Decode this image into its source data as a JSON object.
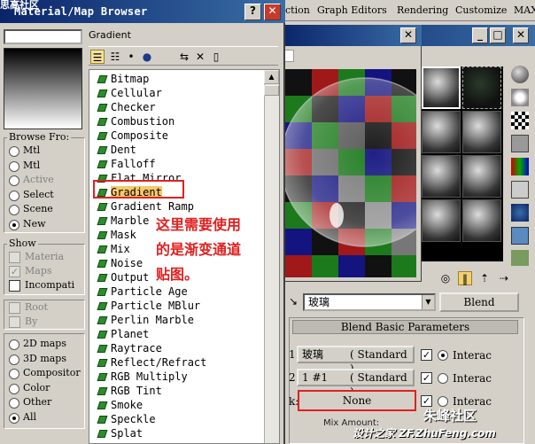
{
  "browser": {
    "title": "Material/Map Browser",
    "watermark_top": "思高社区",
    "path_label": "Gradient",
    "browse_from": {
      "label": "Browse Fro:",
      "options": [
        {
          "label": "Mtl",
          "state": "off",
          "disabled": false
        },
        {
          "label": "Mtl",
          "state": "off",
          "disabled": false
        },
        {
          "label": "Active",
          "state": "off",
          "disabled": true
        },
        {
          "label": "Select",
          "state": "off",
          "disabled": false
        },
        {
          "label": "Scene",
          "state": "off",
          "disabled": false
        },
        {
          "label": "New",
          "state": "on",
          "disabled": false
        }
      ]
    },
    "show": {
      "label": "Show",
      "options": [
        {
          "label": "Materia",
          "checked": false,
          "disabled": true
        },
        {
          "label": "Maps",
          "checked": true,
          "disabled": true
        },
        {
          "label": "Incompati",
          "checked": false,
          "disabled": false
        }
      ]
    },
    "root_options": [
      {
        "label": "Root",
        "disabled": true
      },
      {
        "label": "By",
        "disabled": true
      }
    ],
    "map_filter": [
      {
        "label": "2D maps",
        "state": "off"
      },
      {
        "label": "3D maps",
        "state": "off"
      },
      {
        "label": "Compositor",
        "state": "off"
      },
      {
        "label": "Color",
        "state": "off"
      },
      {
        "label": "Other",
        "state": "off"
      },
      {
        "label": "All",
        "state": "on"
      }
    ],
    "list": [
      "Bitmap",
      "Cellular",
      "Checker",
      "Combustion",
      "Composite",
      "Dent",
      "Falloff",
      "Flat Mirror",
      "Gradient",
      "Gradient Ramp",
      "Marble",
      "Mask",
      "Mix",
      "Noise",
      "Output",
      "Particle Age",
      "Particle MBlur",
      "Perlin Marble",
      "Planet",
      "Raytrace",
      "Reflect/Refract",
      "RGB Multiply",
      "RGB Tint",
      "Smoke",
      "Speckle",
      "Splat"
    ],
    "selected_index": 8
  },
  "annotation": [
    "这里需要使用",
    "的是渐变通道",
    "贴图。"
  ],
  "app": {
    "menu": [
      "ction",
      "Graph Editors",
      "Rendering",
      "Customize",
      "MAXS"
    ]
  },
  "editor": {
    "material_name": "玻璃",
    "material_type": "Blend",
    "rollout_title": "Blend Basic Parameters",
    "rows": [
      {
        "index": "1:",
        "name": "玻璃",
        "type": "( Standard )",
        "interactive": "Interac"
      },
      {
        "index": "2:",
        "name": "1 #1",
        "type": "( Standard )",
        "interactive": "Interac"
      },
      {
        "index": "k:",
        "name": "None",
        "interactive": "Interac"
      }
    ],
    "mix_amount_label": "Mix Amount:"
  },
  "watermark": {
    "logo": "朱峰社区",
    "site": "设计之家 ZF.ZhuFeng.com"
  }
}
